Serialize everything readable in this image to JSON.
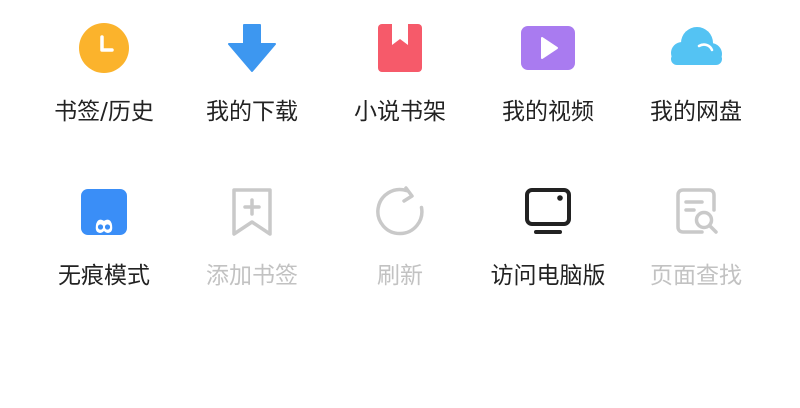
{
  "colors": {
    "history_icon": "#fbb32c",
    "download_icon": "#3d97f0",
    "novel_icon": "#f65a6a",
    "video_icon": "#a97bf0",
    "cloud_icon": "#54c3f3",
    "incognito_icon": "#3a8ef7",
    "label_enabled": "#222222",
    "label_disabled": "#c2c2c2",
    "icon_disabled": "#c9c9c9",
    "icon_dark": "#222222"
  },
  "menu": {
    "row1": [
      {
        "label": "书签/历史",
        "icon": "clock-icon",
        "enabled": true
      },
      {
        "label": "我的下载",
        "icon": "download-arrow-icon",
        "enabled": true
      },
      {
        "label": "小说书架",
        "icon": "book-icon",
        "enabled": true
      },
      {
        "label": "我的视频",
        "icon": "play-icon",
        "enabled": true
      },
      {
        "label": "我的网盘",
        "icon": "cloud-icon",
        "enabled": true
      }
    ],
    "row2": [
      {
        "label": "无痕模式",
        "icon": "mask-icon",
        "enabled": true
      },
      {
        "label": "添加书签",
        "icon": "bookmark-add-icon",
        "enabled": false
      },
      {
        "label": "刷新",
        "icon": "refresh-icon",
        "enabled": false
      },
      {
        "label": "访问电脑版",
        "icon": "monitor-icon",
        "enabled": true
      },
      {
        "label": "页面查找",
        "icon": "page-search-icon",
        "enabled": false
      }
    ]
  }
}
